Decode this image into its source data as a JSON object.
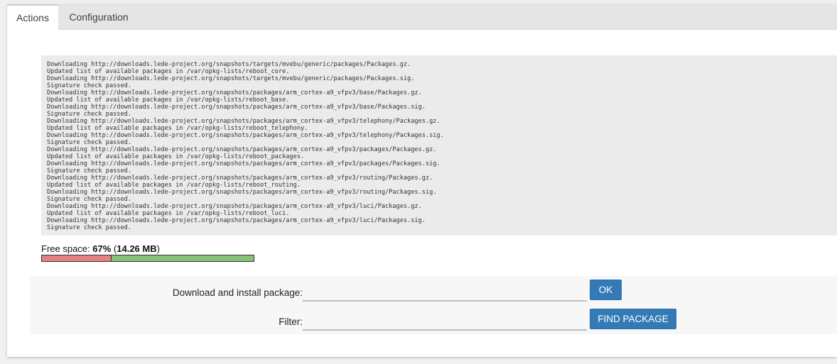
{
  "tabs": [
    {
      "label": "Actions",
      "active": true
    },
    {
      "label": "Configuration",
      "active": false
    }
  ],
  "log": {
    "lines": [
      "Downloading http://downloads.lede-project.org/snapshots/targets/mvebu/generic/packages/Packages.gz.",
      "Updated list of available packages in /var/opkg-lists/reboot_core.",
      "Downloading http://downloads.lede-project.org/snapshots/targets/mvebu/generic/packages/Packages.sig.",
      "Signature check passed.",
      "Downloading http://downloads.lede-project.org/snapshots/packages/arm_cortex-a9_vfpv3/base/Packages.gz.",
      "Updated list of available packages in /var/opkg-lists/reboot_base.",
      "Downloading http://downloads.lede-project.org/snapshots/packages/arm_cortex-a9_vfpv3/base/Packages.sig.",
      "Signature check passed.",
      "Downloading http://downloads.lede-project.org/snapshots/packages/arm_cortex-a9_vfpv3/telephony/Packages.gz.",
      "Updated list of available packages in /var/opkg-lists/reboot_telephony.",
      "Downloading http://downloads.lede-project.org/snapshots/packages/arm_cortex-a9_vfpv3/telephony/Packages.sig.",
      "Signature check passed.",
      "Downloading http://downloads.lede-project.org/snapshots/packages/arm_cortex-a9_vfpv3/packages/Packages.gz.",
      "Updated list of available packages in /var/opkg-lists/reboot_packages.",
      "Downloading http://downloads.lede-project.org/snapshots/packages/arm_cortex-a9_vfpv3/packages/Packages.sig.",
      "Signature check passed.",
      "Downloading http://downloads.lede-project.org/snapshots/packages/arm_cortex-a9_vfpv3/routing/Packages.gz.",
      "Updated list of available packages in /var/opkg-lists/reboot_routing.",
      "Downloading http://downloads.lede-project.org/snapshots/packages/arm_cortex-a9_vfpv3/routing/Packages.sig.",
      "Signature check passed.",
      "Downloading http://downloads.lede-project.org/snapshots/packages/arm_cortex-a9_vfpv3/luci/Packages.gz.",
      "Updated list of available packages in /var/opkg-lists/reboot_luci.",
      "Downloading http://downloads.lede-project.org/snapshots/packages/arm_cortex-a9_vfpv3/luci/Packages.sig.",
      "Signature check passed."
    ]
  },
  "storage": {
    "label": "Free space: ",
    "percent_text": "67%",
    "open_paren": " (",
    "size_text": "14.26 MB",
    "close_paren": ")",
    "used_fraction": 0.33,
    "used_color": "#e88080",
    "free_color": "#88c37a"
  },
  "install": {
    "label": "Download and install package:",
    "value": "",
    "button_label": "OK"
  },
  "filter": {
    "label": "Filter:",
    "value": "",
    "button_label": "FIND PACKAGE"
  },
  "colors": {
    "accent": "#337ab7",
    "tabbar_bg": "#e5e5e5",
    "log_bg": "#ebebeb"
  }
}
